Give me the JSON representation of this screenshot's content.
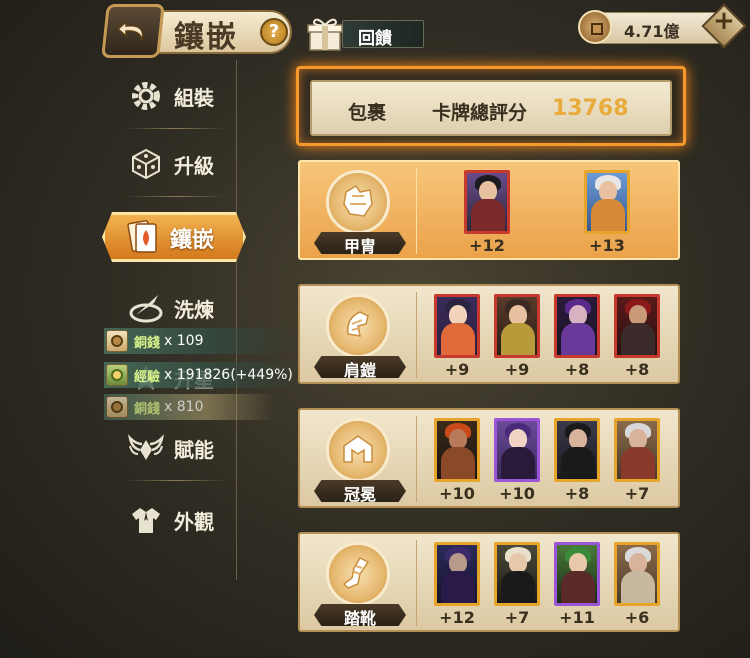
{
  "header": {
    "title": "鑲嵌",
    "help": "?",
    "gift_label": "回饋",
    "currency": "4.71億"
  },
  "sidebar": {
    "items": [
      {
        "label": "組裝",
        "icon": "gear-icon"
      },
      {
        "label": "升級",
        "icon": "dice-icon"
      },
      {
        "label": "鑲嵌",
        "icon": "card-inlay-icon",
        "active": true
      },
      {
        "label": "洗煉",
        "icon": "kunai-icon"
      },
      {
        "label": "升星",
        "icon": "star-icon"
      },
      {
        "label": "賦能",
        "icon": "wings-icon"
      },
      {
        "label": "外觀",
        "icon": "shirt-icon"
      }
    ]
  },
  "rewards": [
    {
      "name": "銅錢",
      "count": "x 109"
    },
    {
      "name": "經驗",
      "count": "x 191826(+449%)"
    },
    {
      "name": "銅錢",
      "count": "x 810"
    }
  ],
  "score": {
    "package": "包裹",
    "label": "卡牌總評分",
    "value": "13768"
  },
  "slots": [
    {
      "name": "甲冑",
      "icon": "armor-icon",
      "active": true,
      "cards": [
        {
          "bonus": "+12",
          "rarity": "red"
        },
        {
          "bonus": "+13",
          "rarity": "gold"
        }
      ]
    },
    {
      "name": "肩鎧",
      "icon": "shoulder-armor-icon",
      "active": false,
      "cards": [
        {
          "bonus": "+9",
          "rarity": "red"
        },
        {
          "bonus": "+9",
          "rarity": "red"
        },
        {
          "bonus": "+8",
          "rarity": "red"
        },
        {
          "bonus": "+8",
          "rarity": "red"
        }
      ]
    },
    {
      "name": "冠冕",
      "icon": "helmet-icon",
      "active": false,
      "cards": [
        {
          "bonus": "+10",
          "rarity": "gold"
        },
        {
          "bonus": "+10",
          "rarity": "purple"
        },
        {
          "bonus": "+8",
          "rarity": "gold"
        },
        {
          "bonus": "+7",
          "rarity": "gold"
        }
      ]
    },
    {
      "name": "踏靴",
      "icon": "boots-icon",
      "active": false,
      "cards": [
        {
          "bonus": "+12",
          "rarity": "gold"
        },
        {
          "bonus": "+7",
          "rarity": "gold"
        },
        {
          "bonus": "+11",
          "rarity": "purple"
        },
        {
          "bonus": "+6",
          "rarity": "gold"
        }
      ]
    }
  ],
  "colors": {
    "accent": "#f59a2a",
    "bonus_text": "#3a3020",
    "score_value": "#e9ac3c"
  }
}
